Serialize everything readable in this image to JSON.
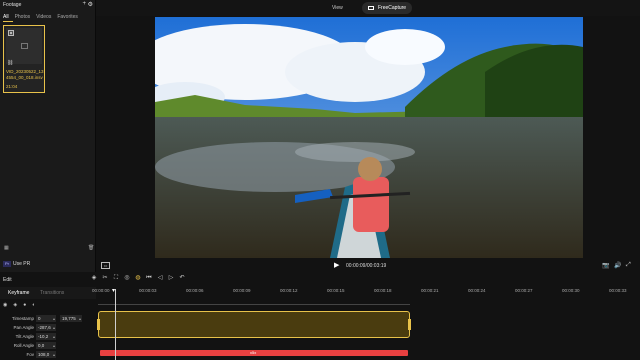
{
  "footage": {
    "title": "Footage",
    "add_icon": "plus-icon",
    "settings_icon": "gear-icon",
    "tabs": [
      "All",
      "Photos",
      "Videos",
      "Favorites"
    ],
    "clip": {
      "name": "VID_20230522_134554_00_018.insv",
      "duration": "21:04"
    },
    "use_pr_badge": "Pr",
    "use_pr": "Use PR"
  },
  "viewer": {
    "view_label": "View",
    "freecapture_label": "FreeCapture"
  },
  "playback": {
    "timecode": "00:00:09/00:03:19"
  },
  "edit": {
    "label": "Edit",
    "tabs": [
      "Keyframe",
      "Transitions"
    ],
    "params": [
      {
        "label": "Timestamp",
        "value": "0",
        "value2": "19,775"
      },
      {
        "label": "Pan Angle",
        "value": "-287,6"
      },
      {
        "label": "Tilt Angle",
        "value": "-10,2"
      },
      {
        "label": "Roll Angle",
        "value": "0,0"
      },
      {
        "label": "Fov",
        "value": "108,0"
      }
    ]
  },
  "timeline": {
    "ruler": [
      "00:00:00",
      "00:00:03",
      "00:00:06",
      "00:00:09",
      "00:00:12",
      "00:00:15",
      "00:00:18",
      "00:00:21",
      "00:00:24",
      "00:00:27",
      "00:00:30",
      "00:00:33"
    ],
    "audio_label": "x5x"
  },
  "colors": {
    "accent": "#e8c24a",
    "audio": "#e84040"
  }
}
